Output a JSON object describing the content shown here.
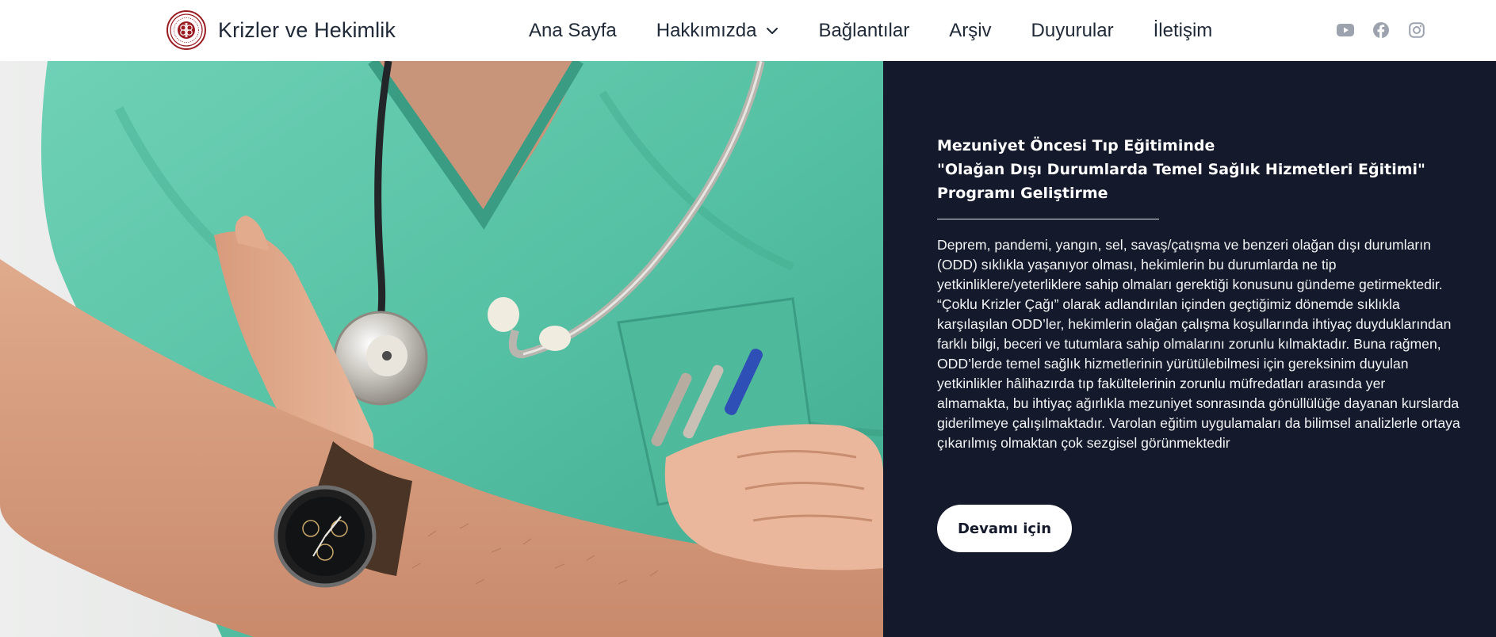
{
  "header": {
    "brand_name": "Krizler ve Hekimlik",
    "logo_icon": "university-seal-logo",
    "nav": [
      {
        "label": "Ana Sayfa"
      },
      {
        "label": "Hakkımızda",
        "has_dropdown": true
      },
      {
        "label": "Bağlantılar"
      },
      {
        "label": "Arşiv"
      },
      {
        "label": "Duyurular"
      },
      {
        "label": "İletişim"
      }
    ],
    "social_icons": [
      "youtube-icon",
      "facebook-icon",
      "instagram-icon"
    ]
  },
  "hero": {
    "image_icon": "doctor-with-stethoscope-photo",
    "title_lines": [
      "Mezuniyet Öncesi Tıp Eğitiminde",
      "\"Olağan Dışı Durumlarda Temel Sağlık Hizmetleri Eğitimi\"",
      "Programı Geliştirme"
    ],
    "body": "Deprem, pandemi, yangın, sel, savaş/çatışma ve benzeri olağan dışı durumların (ODD) sıklıkla yaşanıyor olması, hekimlerin bu durumlarda ne tip yetkinliklere/yeterliklere sahip olmaları gerektiği konusunu gündeme getirmektedir. “Çoklu Krizler Çağı” olarak adlandırılan içinden geçtiğimiz dönemde sıklıkla karşılaşılan ODD’ler, hekimlerin olağan çalışma koşullarında ihtiyaç duyduklarından farklı bilgi, beceri ve tutumlara sahip olmalarını zorunlu kılmaktadır. Buna rağmen, ODD’lerde temel sağlık hizmetlerinin yürütülebilmesi için gereksinim duyulan yetkinlikler hâlihazırda tıp fakültelerinin zorunlu müfredatları arasında yer almamakta, bu ihtiyaç ağırlıkla mezuniyet sonrasında gönüllülüğe dayanan kurslarda giderilmeye çalışılmaktadır. Varolan eğitim uygulamaları da bilimsel analizlerle ortaya çıkarılmış olmaktan çok sezgisel görünmektedir",
    "cta_label": "Devamı için"
  },
  "colors": {
    "panel_bg": "#141a2b",
    "scrubs": "#5dc4a8",
    "logo_red": "#9a1c22",
    "icon_gray": "#9ca3af"
  }
}
